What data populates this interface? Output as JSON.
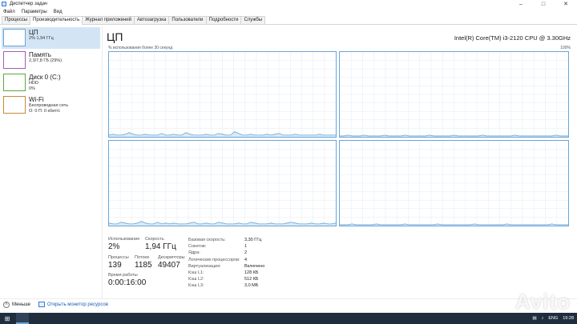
{
  "window": {
    "title": "Диспетчер задач",
    "icon": "task-manager-icon"
  },
  "menu": [
    "Файл",
    "Параметры",
    "Вид"
  ],
  "tabs": [
    {
      "label": "Процессы",
      "active": false
    },
    {
      "label": "Производительность",
      "active": true
    },
    {
      "label": "Журнал приложений",
      "active": false
    },
    {
      "label": "Автозагрузка",
      "active": false
    },
    {
      "label": "Пользователи",
      "active": false
    },
    {
      "label": "Подробности",
      "active": false
    },
    {
      "label": "Службы",
      "active": false
    }
  ],
  "sidebar": {
    "items": [
      {
        "title": "ЦП",
        "sub1": "2% 1,94 ГГц",
        "sub2": "",
        "selected": true
      },
      {
        "title": "Память",
        "sub1": "2,3/7,8 ГБ (29%)",
        "sub2": "",
        "selected": false
      },
      {
        "title": "Диск 0 (C:)",
        "sub1": "HDD",
        "sub2": "0%",
        "selected": false
      },
      {
        "title": "Wi-Fi",
        "sub1": "Беспроводная сеть",
        "sub2": "О: 0 П: 0 кбит/с",
        "selected": false
      }
    ]
  },
  "main": {
    "title": "ЦП",
    "cpu_model": "Intel(R) Core(TM) i3-2120 CPU @ 3.30GHz",
    "util_label": "% использования более 30 секунд",
    "util_max": "100%",
    "graph_color": "#6aa5d8",
    "graph_fill": "#dbeaf7",
    "graphs": [
      {
        "name": "core-0",
        "utilization": [
          2,
          3,
          2,
          2,
          3,
          5,
          3,
          2,
          2,
          3,
          2,
          2,
          2,
          4,
          2,
          2,
          3,
          2,
          2,
          5,
          3,
          2,
          2,
          2,
          3,
          2,
          2,
          4,
          3,
          2,
          2,
          6,
          4,
          2,
          2,
          3,
          2,
          2,
          2,
          3,
          2,
          3,
          4,
          2,
          2,
          2,
          3,
          2,
          2,
          2,
          2,
          2,
          3,
          2,
          2,
          2,
          2
        ]
      },
      {
        "name": "core-1",
        "utilization": [
          1,
          1,
          2,
          1,
          1,
          1,
          2,
          1,
          1,
          1,
          1,
          2,
          1,
          1,
          1,
          1,
          2,
          1,
          1,
          1,
          1,
          1,
          2,
          1,
          1,
          1,
          1,
          1,
          2,
          1,
          1,
          1,
          1,
          1,
          1,
          2,
          1,
          1,
          1,
          1,
          1,
          1,
          1,
          2,
          1,
          1,
          1,
          1,
          1,
          1,
          1,
          1,
          1,
          2,
          1,
          1,
          1
        ]
      },
      {
        "name": "core-2",
        "utilization": [
          3,
          2,
          2,
          4,
          3,
          2,
          2,
          3,
          5,
          3,
          2,
          2,
          4,
          2,
          3,
          2,
          3,
          2,
          2,
          2,
          3,
          4,
          2,
          2,
          3,
          2,
          2,
          4,
          3,
          2,
          2,
          2,
          3,
          2,
          2,
          4,
          3,
          2,
          2,
          2,
          3,
          2,
          2,
          2,
          3,
          4,
          3,
          2,
          2,
          2,
          3,
          2,
          2,
          3,
          2,
          2,
          3
        ]
      },
      {
        "name": "core-3",
        "utilization": [
          1,
          1,
          1,
          2,
          1,
          1,
          1,
          1,
          1,
          2,
          1,
          1,
          1,
          1,
          1,
          1,
          2,
          1,
          1,
          1,
          1,
          1,
          1,
          1,
          2,
          1,
          1,
          1,
          1,
          1,
          1,
          1,
          1,
          2,
          1,
          1,
          1,
          1,
          1,
          1,
          1,
          2,
          1,
          1,
          1,
          1,
          1,
          1,
          1,
          1,
          1,
          1,
          2,
          1,
          1,
          1,
          1
        ]
      }
    ]
  },
  "stats": {
    "utilization_label": "Использование",
    "utilization": "2%",
    "speed_label": "Скорость",
    "speed": "1,94 ГГц",
    "processes_label": "Процессы",
    "processes": "139",
    "threads_label": "Потоки",
    "threads": "1185",
    "handles_label": "Дескрипторы",
    "handles": "49407",
    "uptime_label": "Время работы",
    "uptime": "0:00:16:00"
  },
  "specs": [
    {
      "key": "Базовая скорость:",
      "value": "3,30 ГГц"
    },
    {
      "key": "Сокетов:",
      "value": "1"
    },
    {
      "key": "Ядра:",
      "value": "2"
    },
    {
      "key": "Логических процессоров:",
      "value": "4"
    },
    {
      "key": "Виртуализация:",
      "value": "Включено"
    },
    {
      "key": "Кэш L1:",
      "value": "128 КБ"
    },
    {
      "key": "Кэш L2:",
      "value": "512 КБ"
    },
    {
      "key": "Кэш L3:",
      "value": "3,0 МБ"
    }
  ],
  "footer": {
    "less_label": "Меньше",
    "monitor_label": "Открыть монитор ресурсов"
  },
  "taskbar": {
    "lang": "ENG",
    "time": "19:28"
  },
  "watermark": "Avito"
}
